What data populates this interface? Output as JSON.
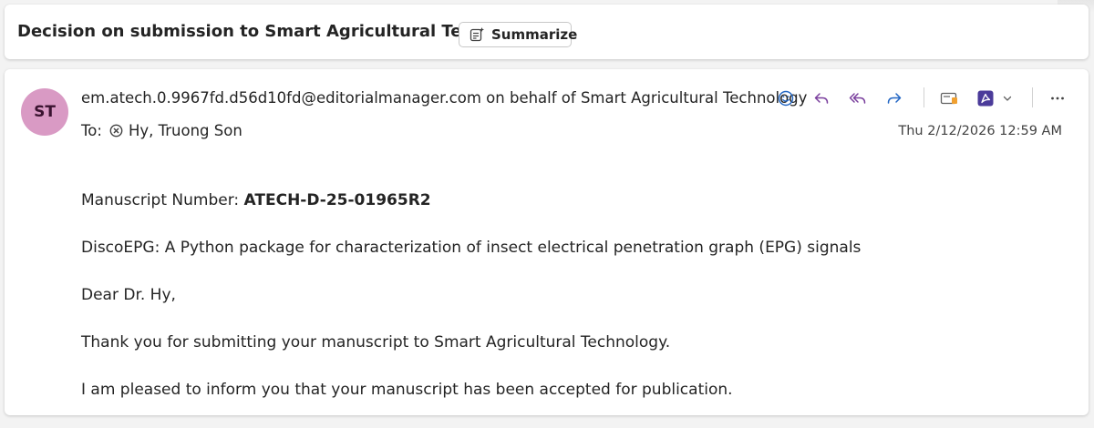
{
  "subject": {
    "title": "Decision on submission to Smart Agricultural Technology",
    "summarize_label": "Summarize"
  },
  "message": {
    "avatar_initials": "ST",
    "sender": "em.atech.0.9967fd.d56d10fd@editorialmanager.com on behalf of Smart Agricultural Technology",
    "to_label": "To:",
    "recipient": "Hy, Truong Son",
    "datetime": "Thu 2/12/2026 12:59 AM",
    "toolbar": [
      "smiley-icon",
      "reply-icon",
      "reply-all-icon",
      "forward-icon",
      "immersive-reader-icon",
      "pdf-icon",
      "chevron-down-icon",
      "more-icon"
    ]
  },
  "body": {
    "manuscript_label": "Manuscript Number: ",
    "manuscript_number": "ATECH-D-25-01965R2",
    "paper_title": "DiscoEPG: A Python package for characterization of insect electrical penetration graph (EPG) signals",
    "salutation": "Dear Dr. Hy,",
    "thanks": "Thank you for submitting your manuscript to Smart Agricultural Technology.",
    "decision": "I am pleased to inform you that your manuscript has been accepted for publication."
  },
  "colors": {
    "accent_purple": "#7a3f9d",
    "accent_blue": "#2266c4",
    "avatar_bg": "#d99ac4",
    "pdf_red": "#b3261e"
  }
}
